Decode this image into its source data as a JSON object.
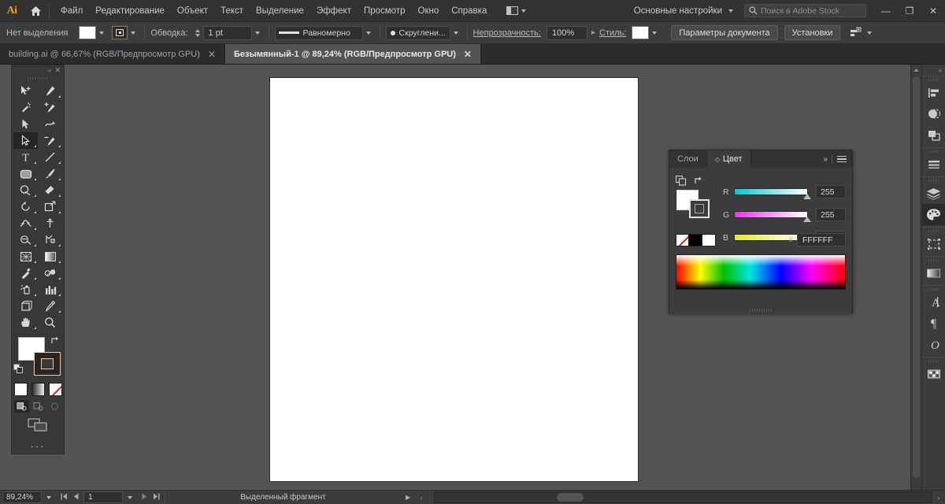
{
  "menubar": {
    "logo": "Ai",
    "home_icon": "home-icon",
    "items": [
      "Файл",
      "Редактирование",
      "Объект",
      "Текст",
      "Выделение",
      "Эффект",
      "Просмотр",
      "Окно",
      "Справка"
    ],
    "arrange_icon": "arrange-documents-icon",
    "workspace": "Основные настройки",
    "search_placeholder": "Поиск в Adobe Stock",
    "search_icon": "search-icon",
    "minimize": "—",
    "restore": "❐",
    "close": "✕"
  },
  "controlbar": {
    "selection_label": "Нет выделения",
    "fill_color": "#FFFFFF",
    "stroke_label": "Обводка:",
    "stroke_weight": "1 pt",
    "profile_label": "Равномерно",
    "brush_label": "Скруглени...",
    "opacity_label": "Непрозрачность:",
    "opacity_value": "100%",
    "style_label": "Стиль:",
    "doc_setup_button": "Параметры документа",
    "preferences_button": "Установки",
    "align_icon": "align-to-selection-icon"
  },
  "tabs": [
    {
      "title": "building.ai @ 66,67% (RGB/Предпросмотр GPU)",
      "active": false,
      "close": "✕"
    },
    {
      "title": "Безымянный-1 @ 89,24% (RGB/Предпросмотр GPU)",
      "active": true,
      "close": "✕"
    }
  ],
  "toolbar": {
    "collapse_icon": "collapse-double-arrow-icon",
    "close_icon": "close-icon",
    "tools": [
      {
        "name": "selection-tool",
        "selected": false,
        "has_flyout": false
      },
      {
        "name": "pen-tool",
        "selected": false,
        "has_flyout": true
      },
      {
        "name": "magic-wand-tool",
        "selected": false,
        "has_flyout": false
      },
      {
        "name": "add-anchor-point-tool",
        "selected": false,
        "has_flyout": false
      },
      {
        "name": "direct-selection-tool-filled",
        "selected": false,
        "has_flyout": true
      },
      {
        "name": "curvature-tool",
        "selected": false,
        "has_flyout": false
      },
      {
        "name": "direct-selection-tool",
        "selected": true,
        "has_flyout": true
      },
      {
        "name": "delete-anchor-point-tool",
        "selected": false,
        "has_flyout": true
      },
      {
        "name": "type-tool",
        "selected": false,
        "has_flyout": true
      },
      {
        "name": "line-segment-tool",
        "selected": false,
        "has_flyout": true
      },
      {
        "name": "rectangle-tool",
        "selected": false,
        "has_flyout": true
      },
      {
        "name": "paintbrush-tool",
        "selected": false,
        "has_flyout": true
      },
      {
        "name": "shaper-tool",
        "selected": false,
        "has_flyout": true
      },
      {
        "name": "eraser-tool",
        "selected": false,
        "has_flyout": true
      },
      {
        "name": "rotate-tool",
        "selected": false,
        "has_flyout": true
      },
      {
        "name": "free-transform-tool",
        "selected": false,
        "has_flyout": true
      },
      {
        "name": "width-tool",
        "selected": false,
        "has_flyout": true
      },
      {
        "name": "puppet-warp-tool",
        "selected": false,
        "has_flyout": false
      },
      {
        "name": "shape-builder-tool",
        "selected": false,
        "has_flyout": true
      },
      {
        "name": "gradient-mesh-tool",
        "selected": false,
        "has_flyout": true
      },
      {
        "name": "perspective-grid-tool",
        "selected": false,
        "has_flyout": true
      },
      {
        "name": "gradient-tool",
        "selected": false,
        "has_flyout": true
      },
      {
        "name": "eyedropper-tool",
        "selected": false,
        "has_flyout": true
      },
      {
        "name": "blend-tool",
        "selected": false,
        "has_flyout": true
      },
      {
        "name": "symbol-sprayer-tool",
        "selected": false,
        "has_flyout": true
      },
      {
        "name": "column-graph-tool",
        "selected": false,
        "has_flyout": true
      },
      {
        "name": "artboard-tool",
        "selected": false,
        "has_flyout": false
      },
      {
        "name": "slice-tool",
        "selected": false,
        "has_flyout": true
      },
      {
        "name": "hand-tool",
        "selected": false,
        "has_flyout": true
      },
      {
        "name": "zoom-tool",
        "selected": false,
        "has_flyout": false
      }
    ],
    "fill_color": "#FFFFFF",
    "stroke_color": "#2E2219",
    "swap_icon": "swap-fill-stroke-icon",
    "default_icon": "default-fill-stroke-icon",
    "fill_modes": [
      "color-swatch",
      "gradient-swatch",
      "none-swatch"
    ],
    "draw_modes": [
      "draw-normal",
      "draw-behind",
      "draw-inside"
    ],
    "screen_mode": "change-screen-mode-icon",
    "more_tools": "···"
  },
  "rail": {
    "collapse_icon": "collapse-double-arrow-icon",
    "groups": [
      [
        "align-panel-icon",
        "pathfinder-panel-icon",
        "transform-panel-icon"
      ],
      [
        "stroke-panel-icon"
      ],
      [
        "layers-panel-icon",
        "color-panel-icon"
      ],
      [
        "artboards-panel-icon"
      ],
      [
        "gradient-panel-icon"
      ],
      [
        "character-panel-icon",
        "paragraph-panel-icon",
        "glyphs-panel-icon"
      ],
      [
        "swatches-panel-icon"
      ]
    ],
    "active": "color-panel-icon"
  },
  "color_panel": {
    "tabs": [
      {
        "label": "Слои",
        "active": false
      },
      {
        "label": "Цвет",
        "active": true
      }
    ],
    "collapse_icon": "collapse-double-arrow-icon",
    "menu_icon": "panel-menu-icon",
    "fill_color": "#FFFFFF",
    "stroke_color": "none",
    "stack_icon": "fill-stroke-stack-icon",
    "swap_icon": "swap-fill-stroke-icon",
    "sliders": [
      {
        "label": "R",
        "value": "255"
      },
      {
        "label": "G",
        "value": "255"
      },
      {
        "label": "B",
        "value": "255"
      }
    ],
    "hash": "#",
    "hex": "FFFFFF",
    "quick_swatches": [
      "none",
      "#000000",
      "#FFFFFF"
    ],
    "spectrum": "color-spectrum-ramp"
  },
  "statusbar": {
    "zoom": "89,24%",
    "page": "1",
    "status_text": "Выделенный фрагмент",
    "first_icon": "first-artboard-icon",
    "prev_icon": "prev-artboard-icon",
    "next_icon": "next-artboard-icon",
    "last_icon": "last-artboard-icon",
    "play_icon": "status-menu-icon",
    "resize_icon": "resize-grip-icon"
  },
  "canvas": {
    "artboard_fill": "#FFFFFF",
    "background": "#535353"
  }
}
